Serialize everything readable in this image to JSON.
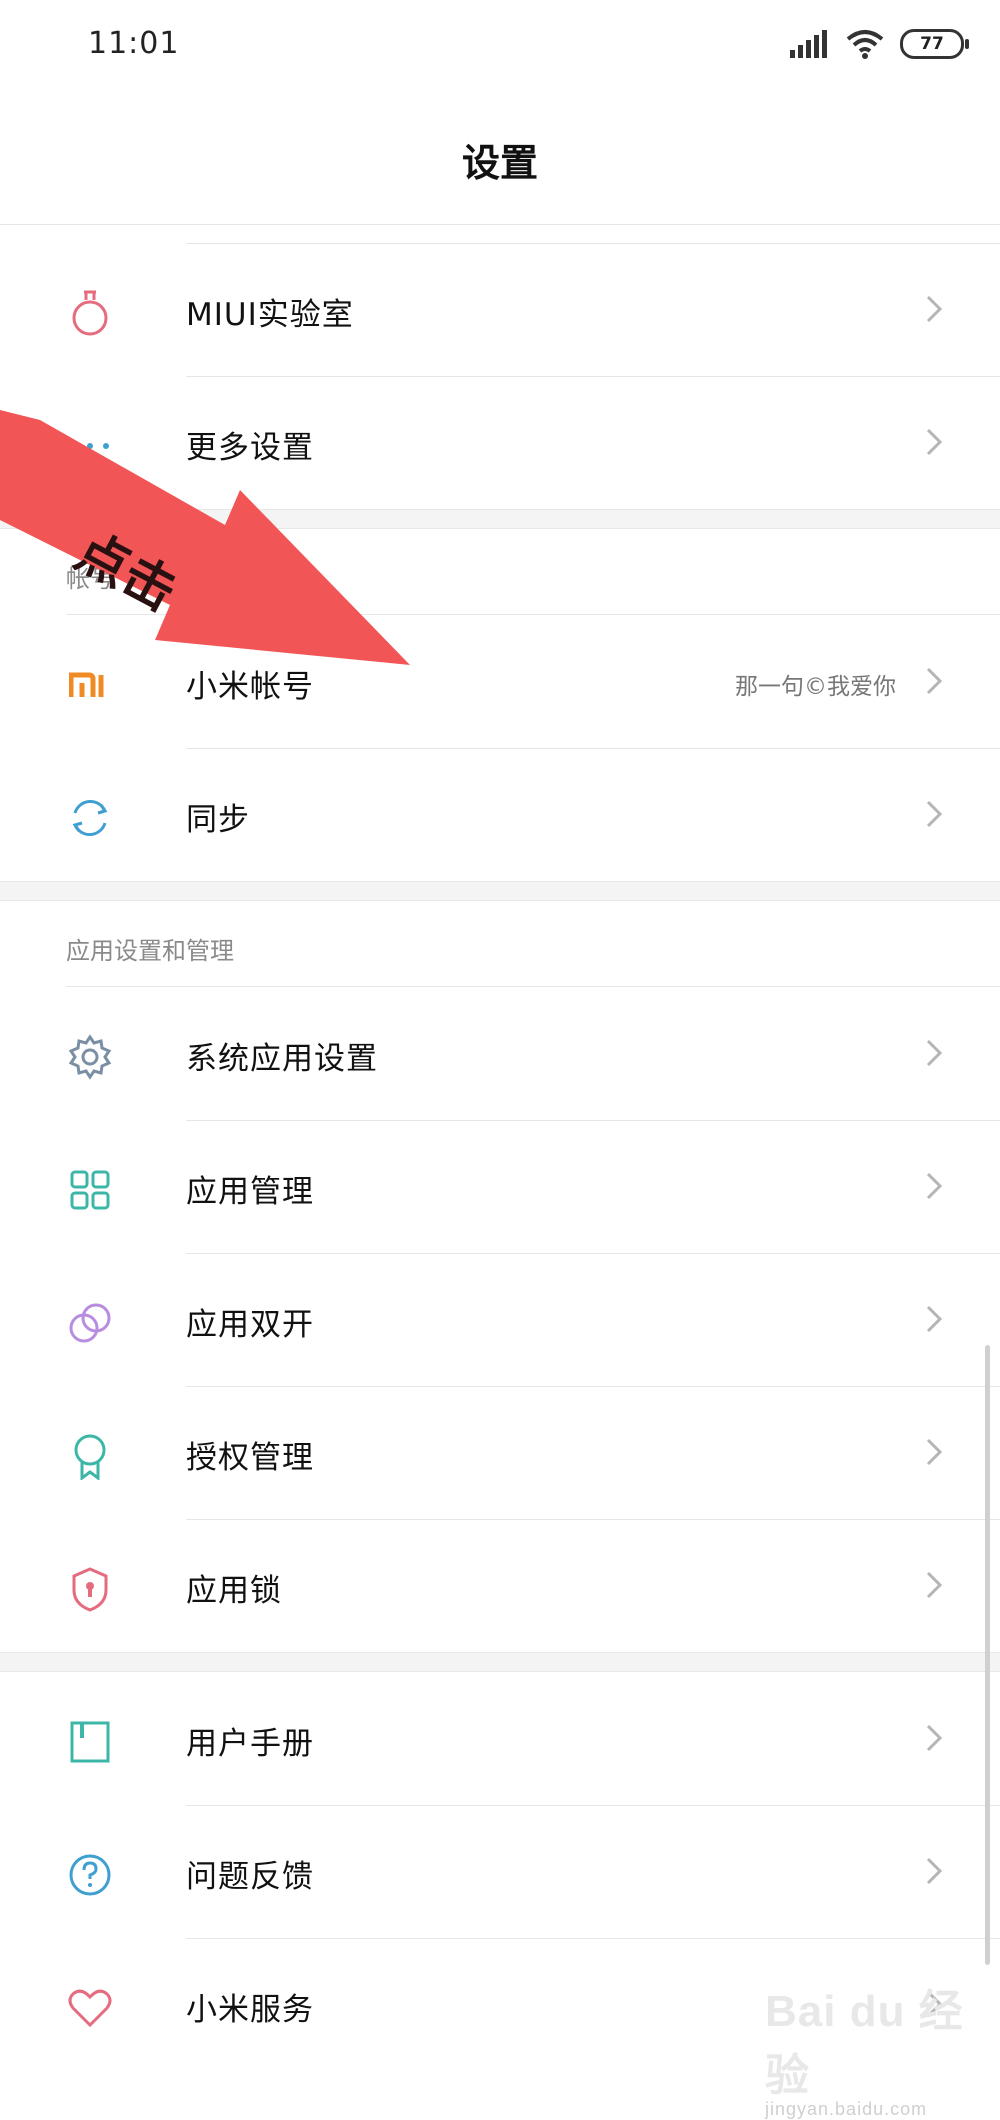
{
  "status_bar": {
    "time": "11:01",
    "battery": "77"
  },
  "header": {
    "title": "设置"
  },
  "sections": [
    {
      "header": "",
      "items": [
        {
          "label": "MIUI实验室",
          "value": "",
          "icon": "flask-icon"
        },
        {
          "label": "更多设置",
          "value": "",
          "icon": "more-dots-icon"
        }
      ]
    },
    {
      "header": "帐号",
      "items": [
        {
          "label": "小米帐号",
          "value": "那一句©我爱你",
          "icon": "mi-logo-icon"
        },
        {
          "label": "同步",
          "value": "",
          "icon": "sync-icon"
        }
      ]
    },
    {
      "header": "应用设置和管理",
      "items": [
        {
          "label": "系统应用设置",
          "value": "",
          "icon": "gear-icon"
        },
        {
          "label": "应用管理",
          "value": "",
          "icon": "grid-icon"
        },
        {
          "label": "应用双开",
          "value": "",
          "icon": "dual-app-icon"
        },
        {
          "label": "授权管理",
          "value": "",
          "icon": "award-icon"
        },
        {
          "label": "应用锁",
          "value": "",
          "icon": "shield-lock-icon"
        }
      ]
    },
    {
      "header": "",
      "items": [
        {
          "label": "用户手册",
          "value": "",
          "icon": "book-icon"
        },
        {
          "label": "问题反馈",
          "value": "",
          "icon": "question-icon"
        },
        {
          "label": "小米服务",
          "value": "",
          "icon": "heart-icon"
        }
      ]
    }
  ],
  "overlay": {
    "arrow_text": "点击"
  },
  "watermark": {
    "logo": "Bai du 经验",
    "url": "jingyan.baidu.com"
  },
  "colors": {
    "arrow": "#f25555",
    "mi_orange": "#f08a24",
    "teal": "#3cb7a7",
    "blue": "#3f9fd0",
    "purple": "#b88de0",
    "pink": "#e56b7f"
  }
}
